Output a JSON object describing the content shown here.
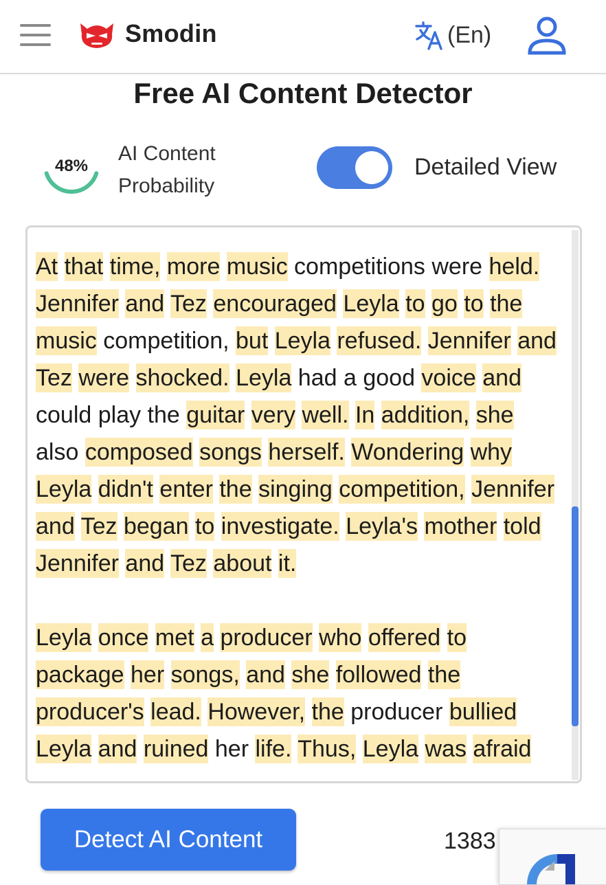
{
  "header": {
    "brand": "Smodin",
    "language_label": "(En)"
  },
  "page": {
    "title": "Free AI Content Detector"
  },
  "score": {
    "percent_text": "48%",
    "percent_value": 48,
    "label_line1": "AI Content",
    "label_line2": "Probability"
  },
  "toggle": {
    "label": "Detailed View",
    "on": true
  },
  "text": {
    "paragraphs": [
      [
        [
          "At",
          true
        ],
        [
          " ",
          false
        ],
        [
          "that",
          true
        ],
        [
          " ",
          false
        ],
        [
          "time,",
          true
        ],
        [
          " ",
          false
        ],
        [
          "more",
          true
        ],
        [
          " ",
          false
        ],
        [
          "music",
          true
        ],
        [
          " competitions were ",
          false
        ],
        [
          "held.",
          true
        ],
        [
          " ",
          false
        ],
        [
          "Jennifer",
          true
        ],
        [
          " ",
          false
        ],
        [
          "and",
          true
        ],
        [
          " ",
          false
        ],
        [
          "Tez",
          true
        ],
        [
          " ",
          false
        ],
        [
          "encouraged",
          true
        ],
        [
          " ",
          false
        ],
        [
          "Leyla",
          true
        ],
        [
          " ",
          false
        ],
        [
          "to",
          true
        ],
        [
          " ",
          false
        ],
        [
          "go",
          true
        ],
        [
          " ",
          false
        ],
        [
          "to",
          true
        ],
        [
          " ",
          false
        ],
        [
          "the",
          true
        ],
        [
          " ",
          false
        ],
        [
          "music",
          true
        ],
        [
          " competition, ",
          false
        ],
        [
          "but",
          true
        ],
        [
          " ",
          false
        ],
        [
          "Leyla",
          true
        ],
        [
          " ",
          false
        ],
        [
          "refused.",
          true
        ],
        [
          " ",
          false
        ],
        [
          "Jennifer",
          true
        ],
        [
          " ",
          false
        ],
        [
          "and",
          true
        ],
        [
          " ",
          false
        ],
        [
          "Tez",
          true
        ],
        [
          " ",
          false
        ],
        [
          "were",
          true
        ],
        [
          " ",
          false
        ],
        [
          "shocked.",
          true
        ],
        [
          " ",
          false
        ],
        [
          "Leyla",
          true
        ],
        [
          " had a good ",
          false
        ],
        [
          "voice",
          true
        ],
        [
          " ",
          false
        ],
        [
          "and",
          true
        ],
        [
          " could play the ",
          false
        ],
        [
          "guitar",
          true
        ],
        [
          " ",
          false
        ],
        [
          "very",
          true
        ],
        [
          " ",
          false
        ],
        [
          "well.",
          true
        ],
        [
          " ",
          false
        ],
        [
          "In",
          true
        ],
        [
          " ",
          false
        ],
        [
          "addition,",
          true
        ],
        [
          " ",
          false
        ],
        [
          "she",
          true
        ],
        [
          " also ",
          false
        ],
        [
          "composed",
          true
        ],
        [
          " ",
          false
        ],
        [
          "songs",
          true
        ],
        [
          " ",
          false
        ],
        [
          "herself.",
          true
        ],
        [
          " ",
          false
        ],
        [
          "Wondering",
          true
        ],
        [
          " ",
          false
        ],
        [
          "why",
          true
        ],
        [
          " ",
          false
        ],
        [
          "Leyla",
          true
        ],
        [
          " ",
          false
        ],
        [
          "didn't",
          true
        ],
        [
          " ",
          false
        ],
        [
          "enter",
          true
        ],
        [
          " ",
          false
        ],
        [
          "the",
          true
        ],
        [
          " ",
          false
        ],
        [
          "singing",
          true
        ],
        [
          " ",
          false
        ],
        [
          "competition,",
          true
        ],
        [
          " ",
          false
        ],
        [
          "Jennifer",
          true
        ],
        [
          " ",
          false
        ],
        [
          "and",
          true
        ],
        [
          " ",
          false
        ],
        [
          "Tez",
          true
        ],
        [
          " ",
          false
        ],
        [
          "began",
          true
        ],
        [
          " ",
          false
        ],
        [
          "to",
          true
        ],
        [
          " ",
          false
        ],
        [
          "investigate.",
          true
        ],
        [
          " ",
          false
        ],
        [
          "Leyla's",
          true
        ],
        [
          " ",
          false
        ],
        [
          "mother",
          true
        ],
        [
          " ",
          false
        ],
        [
          "told",
          true
        ],
        [
          " ",
          false
        ],
        [
          "Jennifer",
          true
        ],
        [
          " ",
          false
        ],
        [
          "and",
          true
        ],
        [
          " ",
          false
        ],
        [
          "Tez",
          true
        ],
        [
          " ",
          false
        ],
        [
          "about",
          true
        ],
        [
          " ",
          false
        ],
        [
          "it.",
          true
        ]
      ],
      [
        [
          "Leyla",
          true
        ],
        [
          " ",
          false
        ],
        [
          "once",
          true
        ],
        [
          " ",
          false
        ],
        [
          "met",
          true
        ],
        [
          " ",
          false
        ],
        [
          "a",
          true
        ],
        [
          " ",
          false
        ],
        [
          "producer",
          true
        ],
        [
          " ",
          false
        ],
        [
          "who",
          true
        ],
        [
          " ",
          false
        ],
        [
          "offered",
          true
        ],
        [
          " ",
          false
        ],
        [
          "to",
          true
        ],
        [
          " ",
          false
        ],
        [
          "package",
          true
        ],
        [
          " ",
          false
        ],
        [
          "her",
          true
        ],
        [
          " ",
          false
        ],
        [
          "songs,",
          true
        ],
        [
          " ",
          false
        ],
        [
          "and",
          true
        ],
        [
          " ",
          false
        ],
        [
          "she",
          true
        ],
        [
          " ",
          false
        ],
        [
          "followed",
          true
        ],
        [
          " ",
          false
        ],
        [
          "the",
          true
        ],
        [
          " ",
          false
        ],
        [
          "producer's",
          true
        ],
        [
          " ",
          false
        ],
        [
          "lead.",
          true
        ],
        [
          " ",
          false
        ],
        [
          "However,",
          true
        ],
        [
          " ",
          false
        ],
        [
          "the",
          true
        ],
        [
          " producer ",
          false
        ],
        [
          "bullied",
          true
        ],
        [
          " ",
          false
        ],
        [
          "Leyla",
          true
        ],
        [
          " ",
          false
        ],
        [
          "and",
          true
        ],
        [
          " ",
          false
        ],
        [
          "ruined",
          true
        ],
        [
          " her ",
          false
        ],
        [
          "life.",
          true
        ],
        [
          " ",
          false
        ],
        [
          "Thus,",
          true
        ],
        [
          " ",
          false
        ],
        [
          "Leyla",
          true
        ],
        [
          " ",
          false
        ],
        [
          "was",
          true
        ],
        [
          " ",
          false
        ],
        [
          "afraid",
          true
        ]
      ]
    ]
  },
  "actions": {
    "detect_label": "Detect AI Content",
    "word_count": "1383"
  },
  "colors": {
    "accent": "#3577e8",
    "highlight": "#fdebb6",
    "gauge": "#4fbf96"
  }
}
